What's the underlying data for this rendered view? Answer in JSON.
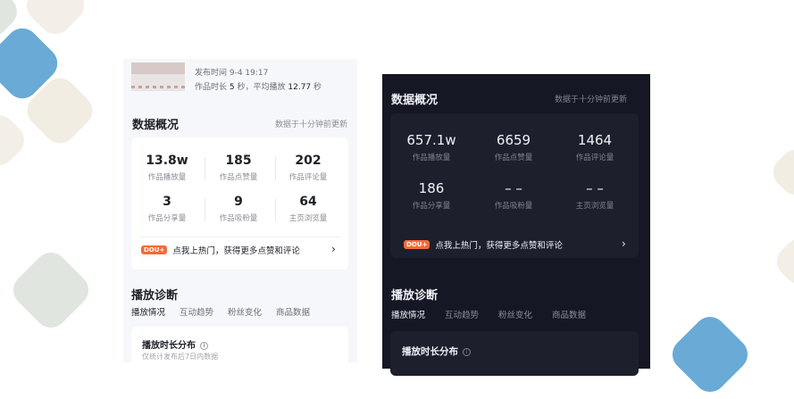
{
  "light_panel": {
    "publish_time": "发布时间 9-4 19:17",
    "duration_prefix": "作品时长",
    "duration_value": "5",
    "duration_unit": "秒，平均播放",
    "avg_play": "12.77",
    "avg_unit": "秒",
    "overview_title": "数据概况",
    "overview_sub": "数据于十分钟前更新",
    "stats": [
      {
        "value": "13.8w",
        "label": "作品播放量"
      },
      {
        "value": "185",
        "label": "作品点赞量"
      },
      {
        "value": "202",
        "label": "作品评论量"
      },
      {
        "value": "3",
        "label": "作品分享量"
      },
      {
        "value": "9",
        "label": "作品吸粉量"
      },
      {
        "value": "64",
        "label": "主页浏览量"
      }
    ],
    "promo_badge": "DOU+",
    "promo_text": "点我上热门，获得更多点赞和评论",
    "diag_title": "播放诊断",
    "tabs": [
      "播放情况",
      "互动趋势",
      "粉丝变化",
      "商品数据"
    ],
    "dist_title": "播放时长分布",
    "dist_note": "仅统计发布后7日内数据"
  },
  "dark_panel": {
    "overview_title": "数据概况",
    "overview_sub": "数据于十分钟前更新",
    "stats": [
      {
        "value": "657.1w",
        "label": "作品播放量"
      },
      {
        "value": "6659",
        "label": "作品点赞量"
      },
      {
        "value": "1464",
        "label": "作品评论量"
      },
      {
        "value": "186",
        "label": "作品分享量"
      },
      {
        "value": "– –",
        "label": "作品吸粉量"
      },
      {
        "value": "– –",
        "label": "主页浏览量"
      }
    ],
    "promo_badge": "DOU+",
    "promo_text": "点我上热门，获得更多点赞和评论",
    "diag_title": "播放诊断",
    "tabs": [
      "播放情况",
      "互动趋势",
      "粉丝变化",
      "商品数据"
    ],
    "dist_title": "播放时长分布"
  },
  "colors": {
    "accent_orange": "#f26b3a",
    "deco_blue": "#6aaad6",
    "deco_cream": "#f2ede2",
    "deco_green": "#e0e6df"
  }
}
